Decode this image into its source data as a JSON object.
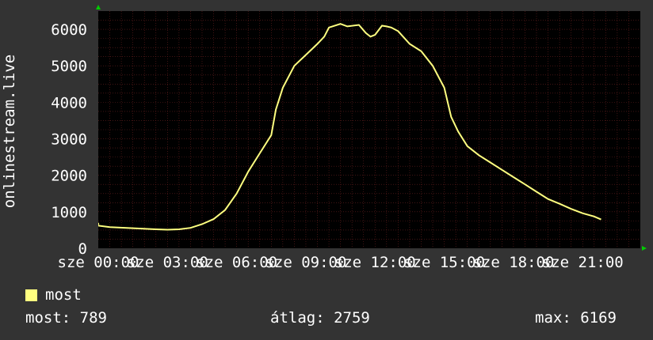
{
  "chart_data": {
    "type": "line",
    "ylabel": "onlinestream.live",
    "ylim": [
      0,
      6500
    ],
    "yticks": [
      0,
      1000,
      2000,
      3000,
      4000,
      5000,
      6000
    ],
    "xlim": [
      0,
      23.5
    ],
    "xticks": [
      {
        "x": 0,
        "label": "sze 00:00"
      },
      {
        "x": 3,
        "label": "sze 03:00"
      },
      {
        "x": 6,
        "label": "sze 06:00"
      },
      {
        "x": 9,
        "label": "sze 09:00"
      },
      {
        "x": 12,
        "label": "sze 12:00"
      },
      {
        "x": 15,
        "label": "sze 15:00"
      },
      {
        "x": 18,
        "label": "sze 18:00"
      },
      {
        "x": 21,
        "label": "sze 21:00"
      }
    ],
    "grid": true,
    "colors": {
      "background": "#333333",
      "plot_area": "#000000",
      "grid_line": "#6a2020",
      "axis_arrow": "#00cc00",
      "series": "#ffff80"
    },
    "series": [
      {
        "name": "most",
        "x": [
          -1.5,
          -0.5,
          0.5,
          1.5,
          2.5,
          3.0,
          3.5,
          4.0,
          4.5,
          5.0,
          5.5,
          6.0,
          6.5,
          7.0,
          7.5,
          7.7,
          8.0,
          8.5,
          9.0,
          9.5,
          9.8,
          10.0,
          10.5,
          10.8,
          11.3,
          11.6,
          11.7,
          11.8,
          12.0,
          12.3,
          12.5,
          12.7,
          13.0,
          13.5,
          14.0,
          14.5,
          15.0,
          15.3,
          15.6,
          16.0,
          16.5,
          17.0,
          17.5,
          18.0,
          18.5,
          19.0,
          19.5,
          20.0,
          20.5,
          21.0,
          21.5,
          21.8
        ],
        "y": [
          700,
          620,
          580,
          550,
          520,
          510,
          520,
          560,
          660,
          800,
          1050,
          1500,
          2100,
          2600,
          3100,
          3800,
          4400,
          5000,
          5300,
          5600,
          5800,
          6050,
          6150,
          6080,
          6120,
          5900,
          5850,
          5800,
          5850,
          6100,
          6080,
          6050,
          5950,
          5600,
          5400,
          5000,
          4400,
          3600,
          3200,
          2800,
          2550,
          2350,
          2150,
          1950,
          1750,
          1550,
          1350,
          1220,
          1080,
          960,
          870,
          789
        ]
      }
    ]
  },
  "legend": {
    "label": "most",
    "color": "#ffff80"
  },
  "stats": {
    "current": "most: 789",
    "average": "átlag: 2759",
    "max": "max: 6169"
  }
}
